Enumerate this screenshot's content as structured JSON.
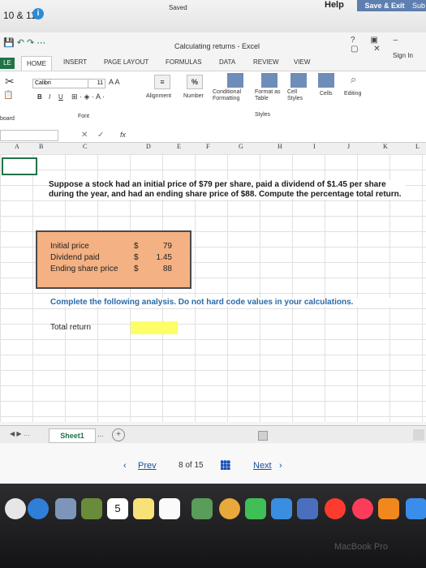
{
  "browser": {
    "title": "10 & 11",
    "info_badge": "i",
    "saved": "Saved",
    "help": "Help",
    "save_exit": "Save & Exit",
    "submit_partial": "Sub"
  },
  "excel": {
    "title": "Calculating returns - Excel",
    "window_controls": "? ▣ – ▢ ✕",
    "sign_in": "Sign In",
    "tabs": {
      "file": "LE",
      "home": "HOME",
      "insert": "INSERT",
      "page_layout": "PAGE LAYOUT",
      "formulas": "FORMULAS",
      "data": "DATA",
      "review": "REVIEW",
      "view": "VIEW"
    },
    "ribbon": {
      "clipboard_label": "board",
      "font_name": "Calibri",
      "font_size": "11",
      "font_label": "Font",
      "bold": "B",
      "italic": "I",
      "underline": "U",
      "alignment": "Alignment",
      "number": "Number",
      "percent": "%",
      "conditional_formatting": "Conditional Formatting",
      "format_as_table": "Format as Table",
      "cell_styles": "Cell Styles",
      "styles_label": "Styles",
      "cells": "Cells",
      "editing": "Editing"
    },
    "formula_bar": {
      "fx": "fx",
      "cancel": "✕",
      "enter": "✓"
    },
    "columns": [
      "A",
      "B",
      "C",
      "D",
      "E",
      "F",
      "G",
      "H",
      "I",
      "J",
      "K",
      "L"
    ],
    "question": "Suppose a stock had an initial price of $79 per share, paid a dividend of $1.45 per share during the year, and had an ending share price of $88. Compute the percentage total return.",
    "inputs": [
      {
        "label": "Initial price",
        "currency": "$",
        "value": "79"
      },
      {
        "label": "Dividend paid",
        "currency": "$",
        "value": "1.45"
      },
      {
        "label": "Ending share price",
        "currency": "$",
        "value": "88"
      }
    ],
    "instruction": "Complete the following analysis. Do not hard code values in your calculations.",
    "total_return_label": "Total return",
    "sheet_tab": "Sheet1",
    "sheet_more": "...",
    "add_sheet": "+"
  },
  "pager": {
    "prev": "Prev",
    "page_info": "8 of 15",
    "next": "Next"
  },
  "dock": {
    "calendar_day": "5",
    "watermark": "MacBook Pro"
  }
}
